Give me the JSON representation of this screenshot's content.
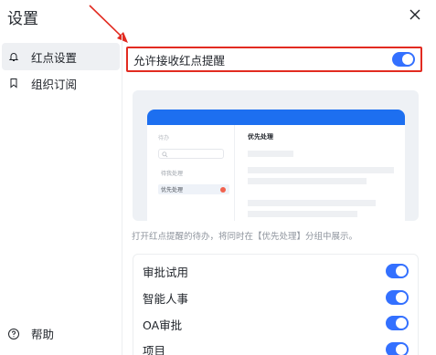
{
  "dialog": {
    "title": "设置"
  },
  "sidebar": {
    "items": [
      {
        "label": "红点设置",
        "icon": "bell-icon",
        "active": true
      },
      {
        "label": "组织订阅",
        "icon": "bookmark-icon",
        "active": false
      }
    ],
    "help": {
      "label": "帮助",
      "icon": "question-circle-icon"
    }
  },
  "main": {
    "allow_red_dot": {
      "label": "允许接收红点提醒",
      "enabled": true
    },
    "preview": {
      "todo_label": "待办",
      "items": [
        "待我处理",
        "优先处理"
      ],
      "heading": "优先处理"
    },
    "description": "打开红点提醒的待办，将同时在【优先处理】分组中展示。",
    "apps": [
      {
        "label": "审批试用",
        "enabled": true
      },
      {
        "label": "智能人事",
        "enabled": true
      },
      {
        "label": "OA审批",
        "enabled": true
      },
      {
        "label": "项目",
        "enabled": true
      }
    ]
  },
  "colors": {
    "accent": "#3370ff",
    "annotation": "#e22b21",
    "preview_bar": "#1d6ff0"
  }
}
